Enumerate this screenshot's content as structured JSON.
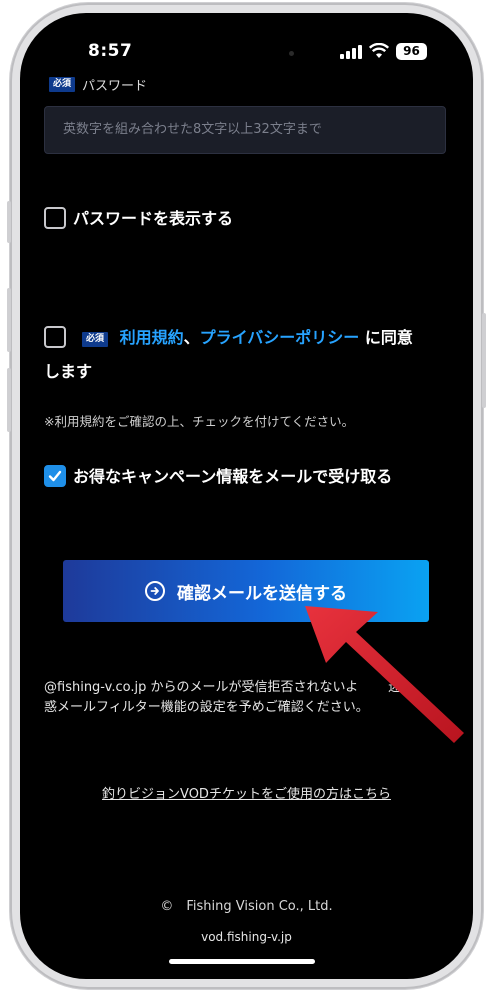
{
  "status_bar": {
    "time": "8:57",
    "battery": "96"
  },
  "form": {
    "password_label_badge": "必須",
    "password_label": "パスワード",
    "password_placeholder": "英数字を組み合わせた8文字以上32文字まで",
    "show_password_label": "パスワードを表示する",
    "agree": {
      "badge": "必須",
      "terms_link": "利用規約",
      "separator": "、",
      "privacy_link": "プライバシーポリシー",
      "suffix": " に同意",
      "line2": "します"
    },
    "agree_note": "※利用規約をご確認の上、チェックを付けてください。",
    "campaign_label": "お得なキャンペーン情報をメールで受け取る",
    "submit_label": "確認メールを送信する"
  },
  "info_text_line1": "@fishing-v.co.jp からのメールが受信拒否されないよ",
  "info_text_line1b": "迷",
  "info_text_line2": "惑メールフィルター機能の設定を予めご確認ください。",
  "ticket_link": "釣りビジョンVODチケットをご使用の方はこちら",
  "footer": {
    "copyright": "©　Fishing Vision Co., Ltd.",
    "domain": "vod.fishing-v.jp"
  },
  "colors": {
    "accent": "#1f8fe8",
    "link": "#27a3ff",
    "annotation_arrow": "#d81e2c"
  },
  "icons": [
    "wifi-icon",
    "cellular-signal-icon",
    "battery-icon",
    "checkmark-icon",
    "arrow-right-circle-icon"
  ]
}
